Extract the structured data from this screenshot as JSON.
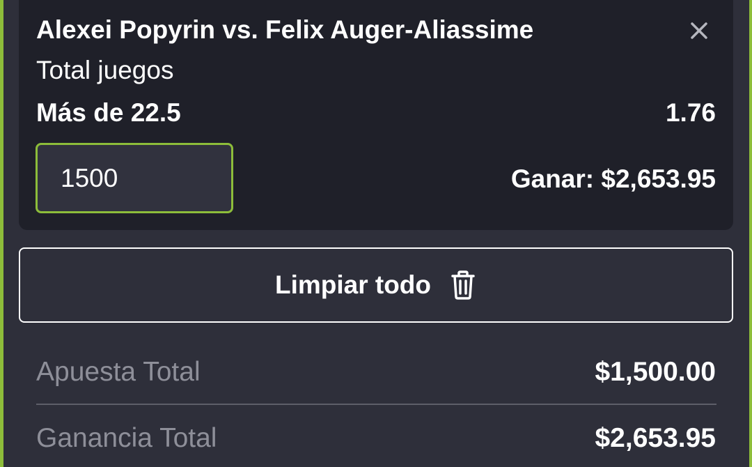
{
  "bet": {
    "event": "Alexei Popyrin vs. Felix Auger-Aliassime",
    "market": "Total juegos",
    "selection": "Más de 22.5",
    "odds": "1.76",
    "stake": "1500",
    "to_win_label": "Ganar:",
    "to_win_value": "$2,653.95",
    "close_icon": "close-icon"
  },
  "actions": {
    "clear_all_label": "Limpiar todo",
    "clear_all_icon": "trash-icon"
  },
  "summary": {
    "total_stake_label": "Apuesta Total",
    "total_stake_value": "$1,500.00",
    "total_win_label": "Ganancia Total",
    "total_win_value": "$2,653.95"
  },
  "colors": {
    "accent": "#8dbd3a",
    "card_bg": "#1f2029",
    "panel_bg": "#2e2f3a",
    "muted_text": "#8e8f99"
  }
}
